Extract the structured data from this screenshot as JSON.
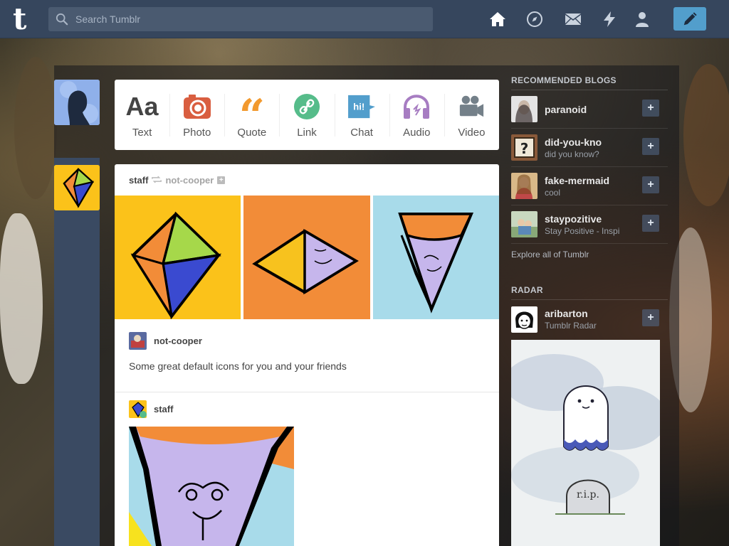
{
  "header": {
    "logo": "t",
    "search_placeholder": "Search Tumblr",
    "nav_icons": [
      "home-icon",
      "compass-icon",
      "mail-icon",
      "lightning-icon",
      "account-icon"
    ],
    "compose_icon": "pencil-icon"
  },
  "post_types": [
    {
      "label": "Text",
      "icon": "text-icon",
      "color": "#444444"
    },
    {
      "label": "Photo",
      "icon": "camera-icon",
      "color": "#d95e40"
    },
    {
      "label": "Quote",
      "icon": "quote-icon",
      "color": "#f2992e"
    },
    {
      "label": "Link",
      "icon": "link-icon",
      "color": "#56bc8a"
    },
    {
      "label": "Chat",
      "icon": "chat-icon",
      "color": "#529ecc"
    },
    {
      "label": "Audio",
      "icon": "headphones-icon",
      "color": "#a77dc2"
    },
    {
      "label": "Video",
      "icon": "video-camera-icon",
      "color": "#748089"
    }
  ],
  "post": {
    "author": "staff",
    "reblogged_from": "not-cooper",
    "reblog_user": "not-cooper",
    "caption": "Some great default icons for you and your friends",
    "original_user": "staff"
  },
  "sidebar": {
    "recommended_title": "RECOMMENDED BLOGS",
    "blogs": [
      {
        "name": "paranoid",
        "subtitle": ""
      },
      {
        "name": "did-you-kno",
        "subtitle": "did you know?"
      },
      {
        "name": "fake-mermaid",
        "subtitle": "cool"
      },
      {
        "name": "staypozitive",
        "subtitle": "Stay Positive - Inspi"
      }
    ],
    "explore": "Explore all of Tumblr",
    "radar_title": "RADAR",
    "radar_blog": {
      "name": "aribarton",
      "subtitle": "Tumblr Radar"
    }
  },
  "colors": {
    "header_bg": "#36465d",
    "accent": "#529ecc"
  }
}
